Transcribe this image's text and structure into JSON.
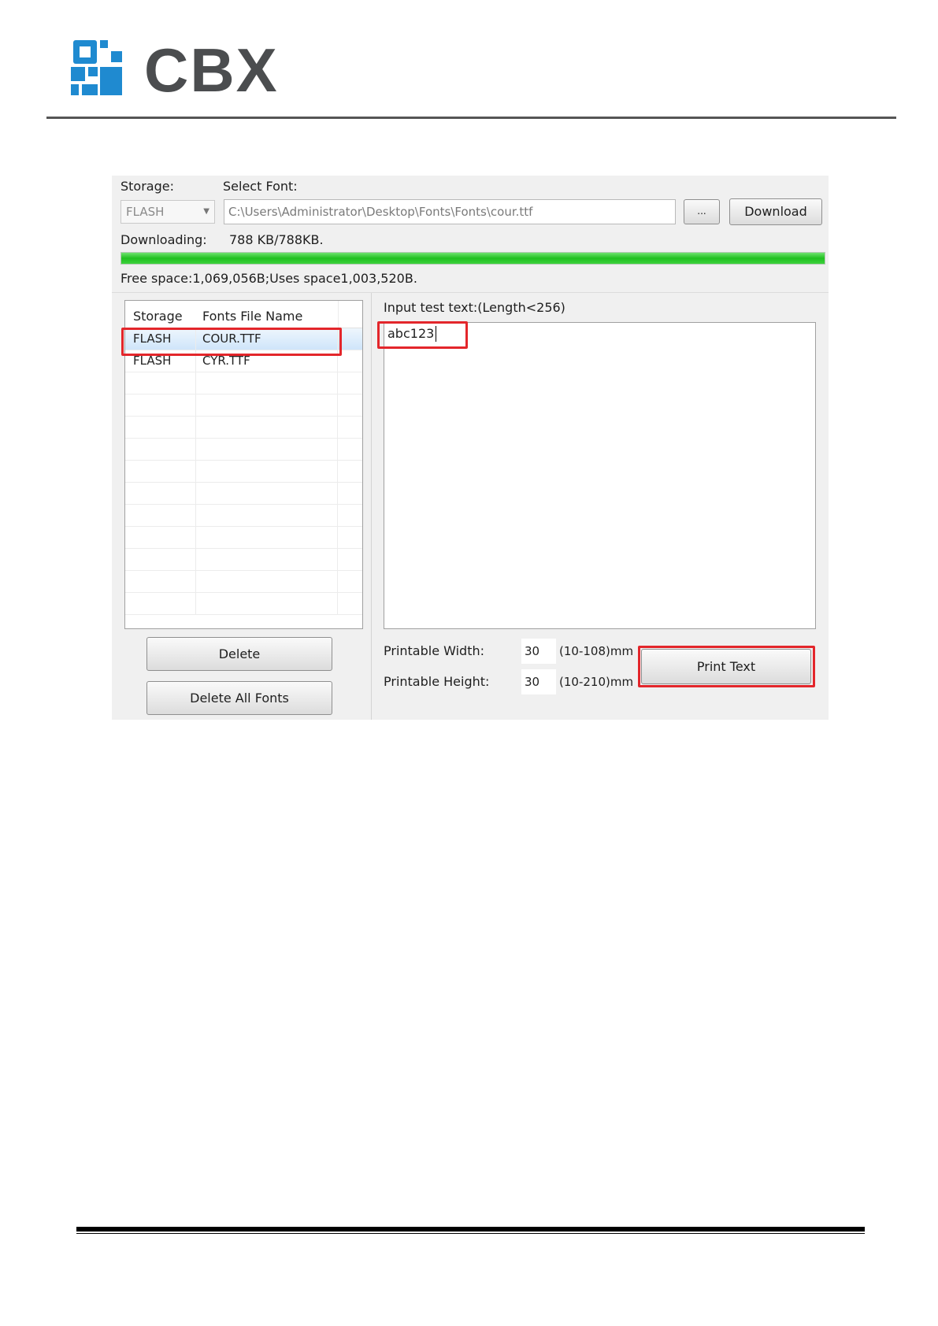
{
  "header": {
    "brand": "CBX",
    "colors": {
      "logo_blue": "#1f8ad0",
      "logo_text": "#4b4d4f"
    }
  },
  "app": {
    "storage_label": "Storage:",
    "select_font_label": "Select Font:",
    "storage_value": "FLASH",
    "font_path": "C:\\Users\\Administrator\\Desktop\\Fonts\\Fonts\\cour.ttf",
    "browse_label": "...",
    "download_label": "Download",
    "downloading_label": "Downloading:",
    "downloading_value": "788 KB/788KB.",
    "progress_fraction": 1.0,
    "space_text": "Free space:1,069,056B;Uses space1,003,520B.",
    "font_table": {
      "columns": [
        "Storage",
        "Fonts File Name"
      ],
      "rows": [
        {
          "storage": "FLASH",
          "name": "COUR.TTF",
          "selected": true
        },
        {
          "storage": "FLASH",
          "name": "CYR.TTF",
          "selected": false
        }
      ]
    },
    "delete_label": "Delete",
    "delete_all_label": "Delete All Fonts",
    "input_label": "Input test text:(Length<256)",
    "input_value": "abc123",
    "printable_width_label": "Printable Width:",
    "printable_width_value": "30",
    "printable_width_range": "(10-108)mm",
    "printable_height_label": "Printable Height:",
    "printable_height_value": "30",
    "printable_height_range": "(10-210)mm",
    "print_label": "Print Text",
    "colors": {
      "highlight": "#e3262b",
      "progress": "#20c020",
      "selection": "#cfe5fa"
    }
  }
}
